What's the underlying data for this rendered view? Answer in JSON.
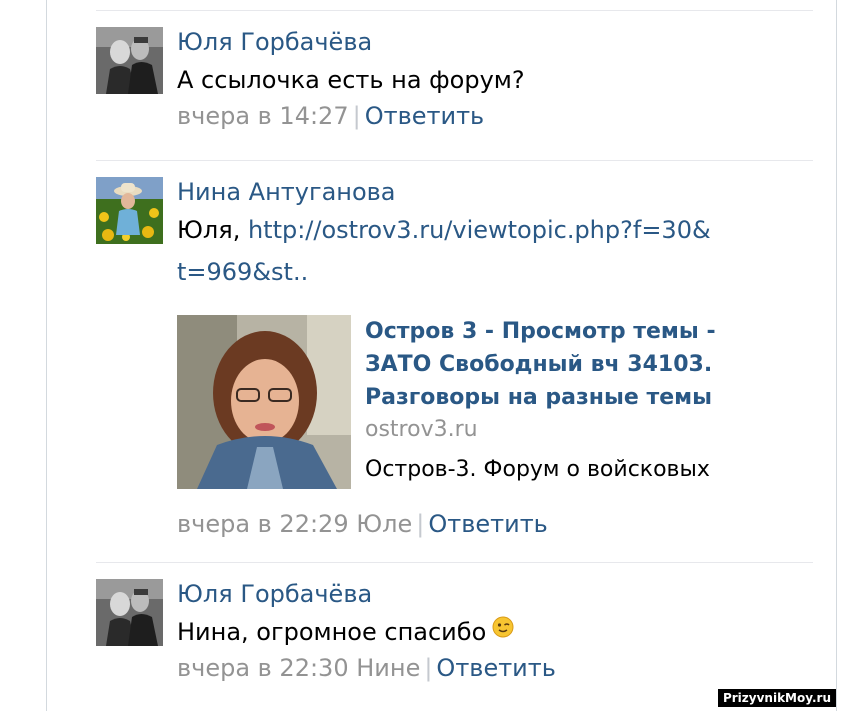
{
  "comments": [
    {
      "author": "Юля Горбачёва",
      "text": "А ссылочка есть на форум?",
      "time": "вчера в 14:27",
      "reply_label": "Ответить",
      "avatar_icon": "bw-couple-photo"
    },
    {
      "author": "Нина Антуганова",
      "text_prefix": "Юля, ",
      "link_text_line1": "http://ostrov3.ru/viewtopic.php?f=30&",
      "link_text_line2": "t=969&st..",
      "time": "вчера в 22:29 Юле",
      "reply_label": "Ответить",
      "avatar_icon": "woman-in-sunflowers-photo",
      "preview": {
        "title": "Остров 3 - Просмотр темы - ЗАТО Свободный вч 34103. Разговоры на разные темы",
        "domain": "ostrov3.ru",
        "description": "Остров-3. Форум о войсковых",
        "thumb_icon": "woman-portrait-photo"
      }
    },
    {
      "author": "Юля Горбачёва",
      "text": "Нина, огромное спасибо",
      "emoji": "wink-emoji",
      "time": "вчера в 22:30 Нине",
      "reply_label": "Ответить",
      "avatar_icon": "bw-couple-photo"
    }
  ],
  "watermark": "PrizyvnikMoy.ru",
  "colors": {
    "author": "#2a5885",
    "meta": "#939393",
    "divider": "#e7e8ec"
  }
}
